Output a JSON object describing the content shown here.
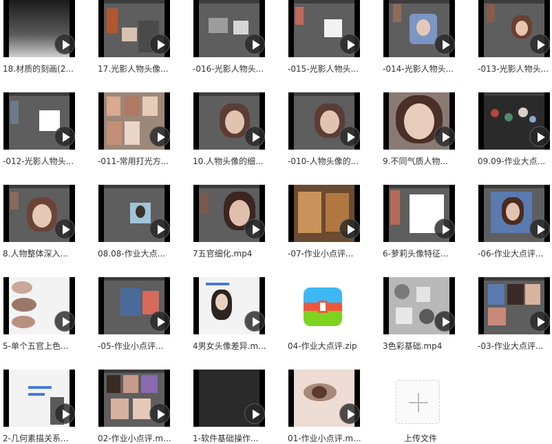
{
  "files": [
    {
      "name": "18.材质的刻画(2..."
    },
    {
      "name": "17.光影人物头像..."
    },
    {
      "name": "-016-光影人物头..."
    },
    {
      "name": "-015-光影人物头..."
    },
    {
      "name": "-014-光影人物头..."
    },
    {
      "name": "-013-光影人物头..."
    },
    {
      "name": "-012-光影人物头..."
    },
    {
      "name": "-011-常用打光方..."
    },
    {
      "name": "10.人物头像的细..."
    },
    {
      "name": "-010-人物头像的..."
    },
    {
      "name": "9.不同气质人物..."
    },
    {
      "name": "09.09-作业大点..."
    },
    {
      "name": "8.人物整体深入..."
    },
    {
      "name": "08.08-作业大点..."
    },
    {
      "name": "7五官细化.mp4"
    },
    {
      "name": "-07-作业小点评..."
    },
    {
      "name": "6-萝莉头像特征..."
    },
    {
      "name": "-06-作业大点评..."
    },
    {
      "name": "5-单个五官上色..."
    },
    {
      "name": "-05-作业小点评..."
    },
    {
      "name": "4男女头像差异.m..."
    },
    {
      "name": "04-作业大点评.zip"
    },
    {
      "name": "3色彩基础.mp4"
    },
    {
      "name": "-03-作业大点评..."
    },
    {
      "name": "2-几何素描关系..."
    },
    {
      "name": "02-作业小点评.m..."
    },
    {
      "name": "1-软件基础操作..."
    },
    {
      "name": "01-作业小点评.m..."
    }
  ],
  "upload": {
    "label": "上传文件"
  },
  "colors": {
    "zip_blue": "#3db8f5",
    "zip_orange": "#f5a623",
    "zip_green": "#7ed321",
    "zip_red": "#f0563b"
  }
}
